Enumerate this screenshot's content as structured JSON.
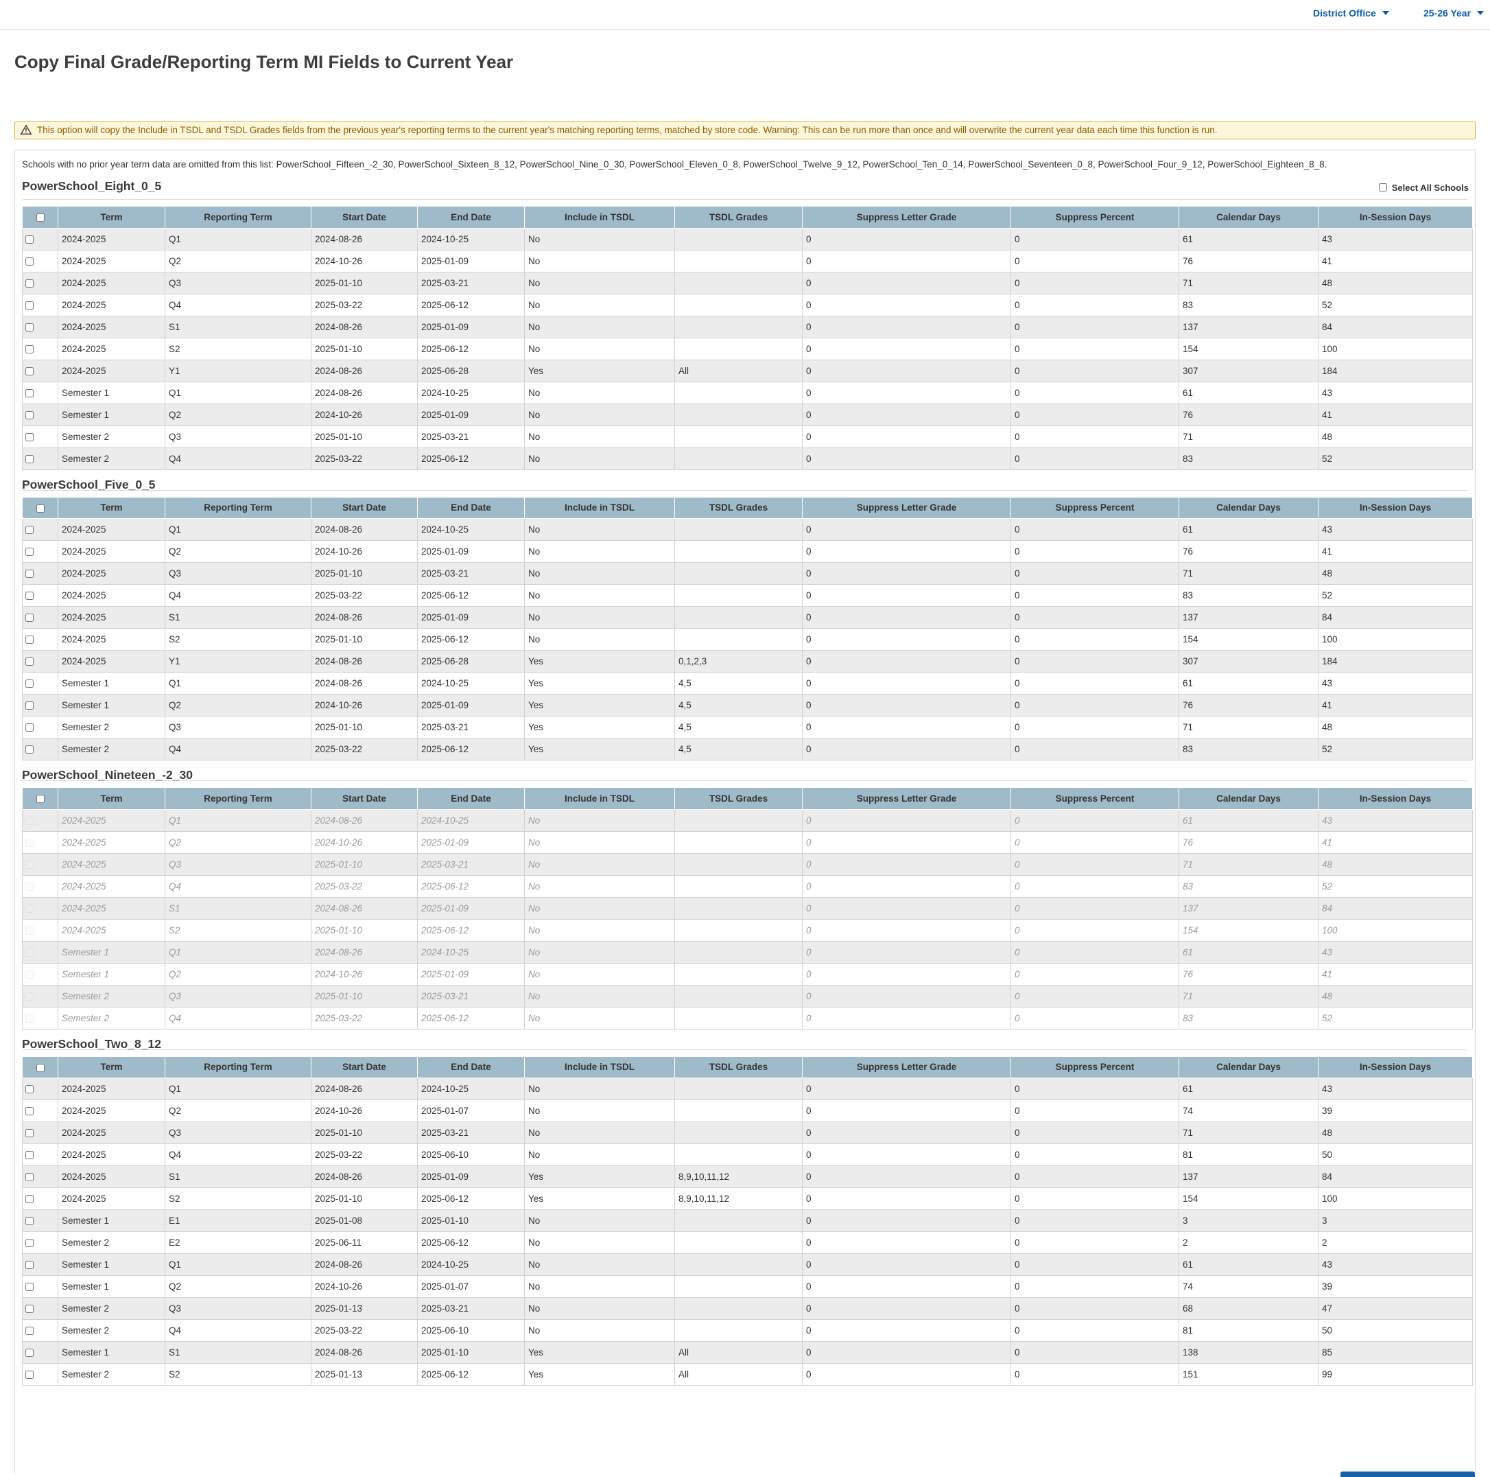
{
  "header": {
    "district_label": "District Office",
    "year_label": "25-26 Year"
  },
  "page_title": "Copy Final Grade/Reporting Term MI Fields to Current Year",
  "warning_text": "This option will copy the Include in TSDL and TSDL Grades fields from the previous year's reporting terms to the current year's matching reporting terms, matched by store code. Warning: This can be run more than once and will overwrite the current year data each time this function is run.",
  "omitted_text": "Schools with no prior year term data are omitted from this list: PowerSchool_Fifteen_-2_30, PowerSchool_Sixteen_8_12, PowerSchool_Nine_0_30, PowerSchool_Eleven_0_8, PowerSchool_Twelve_9_12, PowerSchool_Ten_0_14, PowerSchool_Seventeen_0_8, PowerSchool_Four_9_12, PowerSchool_Eighteen_8_8.",
  "select_all_label": "Select All Schools",
  "columns": [
    "Term",
    "Reporting Term",
    "Start Date",
    "End Date",
    "Include in TSDL",
    "TSDL Grades",
    "Suppress Letter Grade",
    "Suppress Percent",
    "Calendar Days",
    "In-Session Days"
  ],
  "schools": [
    {
      "name": "PowerSchool_Eight_0_5",
      "disabled": false,
      "rows": [
        [
          "2024-2025",
          "Q1",
          "2024-08-26",
          "2024-10-25",
          "No",
          "",
          "0",
          "0",
          "61",
          "43"
        ],
        [
          "2024-2025",
          "Q2",
          "2024-10-26",
          "2025-01-09",
          "No",
          "",
          "0",
          "0",
          "76",
          "41"
        ],
        [
          "2024-2025",
          "Q3",
          "2025-01-10",
          "2025-03-21",
          "No",
          "",
          "0",
          "0",
          "71",
          "48"
        ],
        [
          "2024-2025",
          "Q4",
          "2025-03-22",
          "2025-06-12",
          "No",
          "",
          "0",
          "0",
          "83",
          "52"
        ],
        [
          "2024-2025",
          "S1",
          "2024-08-26",
          "2025-01-09",
          "No",
          "",
          "0",
          "0",
          "137",
          "84"
        ],
        [
          "2024-2025",
          "S2",
          "2025-01-10",
          "2025-06-12",
          "No",
          "",
          "0",
          "0",
          "154",
          "100"
        ],
        [
          "2024-2025",
          "Y1",
          "2024-08-26",
          "2025-06-28",
          "Yes",
          "All",
          "0",
          "0",
          "307",
          "184"
        ],
        [
          "Semester 1",
          "Q1",
          "2024-08-26",
          "2024-10-25",
          "No",
          "",
          "0",
          "0",
          "61",
          "43"
        ],
        [
          "Semester 1",
          "Q2",
          "2024-10-26",
          "2025-01-09",
          "No",
          "",
          "0",
          "0",
          "76",
          "41"
        ],
        [
          "Semester 2",
          "Q3",
          "2025-01-10",
          "2025-03-21",
          "No",
          "",
          "0",
          "0",
          "71",
          "48"
        ],
        [
          "Semester 2",
          "Q4",
          "2025-03-22",
          "2025-06-12",
          "No",
          "",
          "0",
          "0",
          "83",
          "52"
        ]
      ]
    },
    {
      "name": "PowerSchool_Five_0_5",
      "disabled": false,
      "rows": [
        [
          "2024-2025",
          "Q1",
          "2024-08-26",
          "2024-10-25",
          "No",
          "",
          "0",
          "0",
          "61",
          "43"
        ],
        [
          "2024-2025",
          "Q2",
          "2024-10-26",
          "2025-01-09",
          "No",
          "",
          "0",
          "0",
          "76",
          "41"
        ],
        [
          "2024-2025",
          "Q3",
          "2025-01-10",
          "2025-03-21",
          "No",
          "",
          "0",
          "0",
          "71",
          "48"
        ],
        [
          "2024-2025",
          "Q4",
          "2025-03-22",
          "2025-06-12",
          "No",
          "",
          "0",
          "0",
          "83",
          "52"
        ],
        [
          "2024-2025",
          "S1",
          "2024-08-26",
          "2025-01-09",
          "No",
          "",
          "0",
          "0",
          "137",
          "84"
        ],
        [
          "2024-2025",
          "S2",
          "2025-01-10",
          "2025-06-12",
          "No",
          "",
          "0",
          "0",
          "154",
          "100"
        ],
        [
          "2024-2025",
          "Y1",
          "2024-08-26",
          "2025-06-28",
          "Yes",
          "0,1,2,3",
          "0",
          "0",
          "307",
          "184"
        ],
        [
          "Semester 1",
          "Q1",
          "2024-08-26",
          "2024-10-25",
          "Yes",
          "4,5",
          "0",
          "0",
          "61",
          "43"
        ],
        [
          "Semester 1",
          "Q2",
          "2024-10-26",
          "2025-01-09",
          "Yes",
          "4,5",
          "0",
          "0",
          "76",
          "41"
        ],
        [
          "Semester 2",
          "Q3",
          "2025-01-10",
          "2025-03-21",
          "Yes",
          "4,5",
          "0",
          "0",
          "71",
          "48"
        ],
        [
          "Semester 2",
          "Q4",
          "2025-03-22",
          "2025-06-12",
          "Yes",
          "4,5",
          "0",
          "0",
          "83",
          "52"
        ]
      ]
    },
    {
      "name": "PowerSchool_Nineteen_-2_30",
      "disabled": true,
      "rows": [
        [
          "2024-2025",
          "Q1",
          "2024-08-26",
          "2024-10-25",
          "No",
          "",
          "0",
          "0",
          "61",
          "43"
        ],
        [
          "2024-2025",
          "Q2",
          "2024-10-26",
          "2025-01-09",
          "No",
          "",
          "0",
          "0",
          "76",
          "41"
        ],
        [
          "2024-2025",
          "Q3",
          "2025-01-10",
          "2025-03-21",
          "No",
          "",
          "0",
          "0",
          "71",
          "48"
        ],
        [
          "2024-2025",
          "Q4",
          "2025-03-22",
          "2025-06-12",
          "No",
          "",
          "0",
          "0",
          "83",
          "52"
        ],
        [
          "2024-2025",
          "S1",
          "2024-08-26",
          "2025-01-09",
          "No",
          "",
          "0",
          "0",
          "137",
          "84"
        ],
        [
          "2024-2025",
          "S2",
          "2025-01-10",
          "2025-06-12",
          "No",
          "",
          "0",
          "0",
          "154",
          "100"
        ],
        [
          "Semester 1",
          "Q1",
          "2024-08-26",
          "2024-10-25",
          "No",
          "",
          "0",
          "0",
          "61",
          "43"
        ],
        [
          "Semester 1",
          "Q2",
          "2024-10-26",
          "2025-01-09",
          "No",
          "",
          "0",
          "0",
          "76",
          "41"
        ],
        [
          "Semester 2",
          "Q3",
          "2025-01-10",
          "2025-03-21",
          "No",
          "",
          "0",
          "0",
          "71",
          "48"
        ],
        [
          "Semester 2",
          "Q4",
          "2025-03-22",
          "2025-06-12",
          "No",
          "",
          "0",
          "0",
          "83",
          "52"
        ]
      ]
    },
    {
      "name": "PowerSchool_Two_8_12",
      "disabled": false,
      "rows": [
        [
          "2024-2025",
          "Q1",
          "2024-08-26",
          "2024-10-25",
          "No",
          "",
          "0",
          "0",
          "61",
          "43"
        ],
        [
          "2024-2025",
          "Q2",
          "2024-10-26",
          "2025-01-07",
          "No",
          "",
          "0",
          "0",
          "74",
          "39"
        ],
        [
          "2024-2025",
          "Q3",
          "2025-01-10",
          "2025-03-21",
          "No",
          "",
          "0",
          "0",
          "71",
          "48"
        ],
        [
          "2024-2025",
          "Q4",
          "2025-03-22",
          "2025-06-10",
          "No",
          "",
          "0",
          "0",
          "81",
          "50"
        ],
        [
          "2024-2025",
          "S1",
          "2024-08-26",
          "2025-01-09",
          "Yes",
          "8,9,10,11,12",
          "0",
          "0",
          "137",
          "84"
        ],
        [
          "2024-2025",
          "S2",
          "2025-01-10",
          "2025-06-12",
          "Yes",
          "8,9,10,11,12",
          "0",
          "0",
          "154",
          "100"
        ],
        [
          "Semester 1",
          "E1",
          "2025-01-08",
          "2025-01-10",
          "No",
          "",
          "0",
          "0",
          "3",
          "3"
        ],
        [
          "Semester 2",
          "E2",
          "2025-06-11",
          "2025-06-12",
          "No",
          "",
          "0",
          "0",
          "2",
          "2"
        ],
        [
          "Semester 1",
          "Q1",
          "2024-08-26",
          "2024-10-25",
          "No",
          "",
          "0",
          "0",
          "61",
          "43"
        ],
        [
          "Semester 1",
          "Q2",
          "2024-10-26",
          "2025-01-07",
          "No",
          "",
          "0",
          "0",
          "74",
          "39"
        ],
        [
          "Semester 2",
          "Q3",
          "2025-01-13",
          "2025-03-21",
          "No",
          "",
          "0",
          "0",
          "68",
          "47"
        ],
        [
          "Semester 2",
          "Q4",
          "2025-03-22",
          "2025-06-10",
          "No",
          "",
          "0",
          "0",
          "81",
          "50"
        ],
        [
          "Semester 1",
          "S1",
          "2024-08-26",
          "2025-01-10",
          "Yes",
          "All",
          "0",
          "0",
          "138",
          "85"
        ],
        [
          "Semester 2",
          "S2",
          "2025-01-13",
          "2025-06-12",
          "Yes",
          "All",
          "0",
          "0",
          "151",
          "99"
        ]
      ]
    }
  ]
}
